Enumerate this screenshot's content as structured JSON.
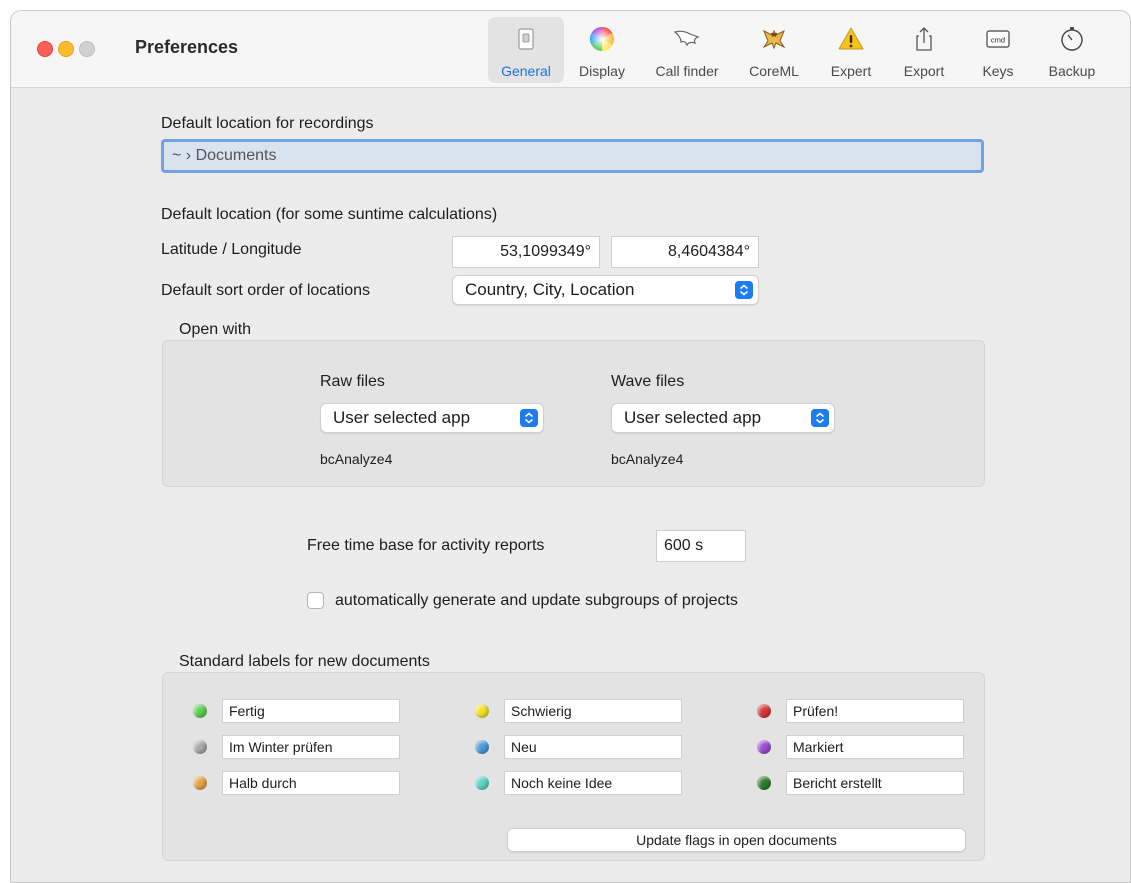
{
  "window": {
    "title": "Preferences"
  },
  "toolbar": {
    "items": [
      {
        "label": "General",
        "icon": "general-switch-icon",
        "selected": true
      },
      {
        "label": "Display",
        "icon": "color-wheel-icon"
      },
      {
        "label": "Call finder",
        "icon": "bat-wing-icon"
      },
      {
        "label": "CoreML",
        "icon": "bat-icon"
      },
      {
        "label": "Expert",
        "icon": "warning-icon"
      },
      {
        "label": "Export",
        "icon": "share-icon"
      },
      {
        "label": "Keys",
        "icon": "cmd-key-icon",
        "icon_text": "cmd"
      },
      {
        "label": "Backup",
        "icon": "stopwatch-icon"
      }
    ],
    "accent": "#1a73e8"
  },
  "general": {
    "recordings_label": "Default location for recordings",
    "recordings_path": "~ › Documents",
    "location_heading": "Default location (for some suntime calculations)",
    "latlon_label": "Latitude / Longitude",
    "latitude": "53,1099349°",
    "longitude": "8,4604384°",
    "sort_label": "Default sort order of locations",
    "sort_value": "Country, City, Location",
    "open_with": {
      "heading": "Open with",
      "raw_label": "Raw files",
      "raw_app": "User selected app",
      "raw_selected": "bcAnalyze4",
      "wave_label": "Wave files",
      "wave_app": "User selected app",
      "wave_selected": "bcAnalyze4"
    },
    "free_time_label": "Free time base for activity reports",
    "free_time_value": "600 s",
    "auto_subgroups_label": "automatically generate and update subgroups of projects",
    "auto_subgroups_checked": false,
    "labels_heading": "Standard labels for new documents",
    "labels": [
      {
        "text": "Fertig",
        "color": "#5fcf52"
      },
      {
        "text": "Im Winter prüfen",
        "color": "#a9a9a9"
      },
      {
        "text": "Halb durch",
        "color": "#e3a447"
      },
      {
        "text": "Schwierig",
        "color": "#f2e227"
      },
      {
        "text": "Neu",
        "color": "#4d9ad8"
      },
      {
        "text": "Noch keine Idee",
        "color": "#5ed4c2"
      },
      {
        "text": "Prüfen!",
        "color": "#d9363b"
      },
      {
        "text": "Markiert",
        "color": "#9b4fd1"
      },
      {
        "text": "Bericht erstellt",
        "color": "#2e7d2a"
      }
    ],
    "update_flags_button": "Update flags in open documents"
  }
}
